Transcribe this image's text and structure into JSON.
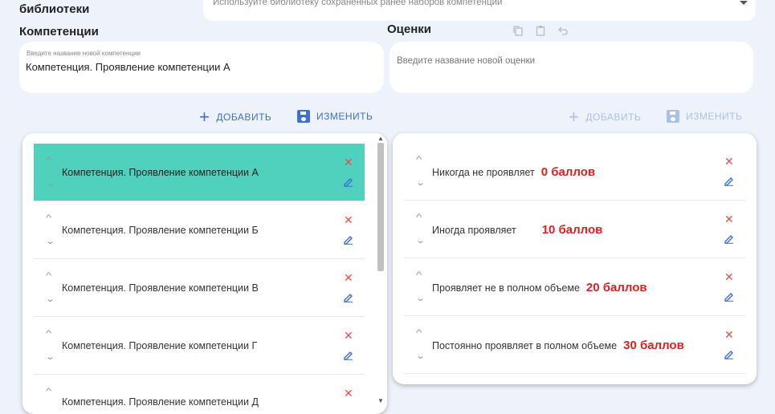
{
  "library": {
    "label": "библиотеки",
    "placeholder": "Используйте библиотеку сохраненных ранее наборов компетенций"
  },
  "competencies": {
    "title": "Компетенции",
    "input_label": "Введите название новой компетенции",
    "input_value": "Компетенция. Проявление компетенции А",
    "add_label": "ДОБАВИТЬ",
    "edit_label": "ИЗМЕНИТЬ",
    "items": [
      {
        "label": "Компетенция. Проявление компетенции А"
      },
      {
        "label": "Компетенция. Проявление компетенции Б"
      },
      {
        "label": "Компетенция. Проявление компетенции В"
      },
      {
        "label": "Компетенция. Проявление компетенции Г"
      },
      {
        "label": "Компетенция. Проявление компетенции Д"
      }
    ]
  },
  "ratings": {
    "title": "Оценки",
    "input_placeholder": "Введите название новой оценки",
    "add_label": "ДОБАВИТЬ",
    "edit_label": "ИЗМЕНИТЬ",
    "items": [
      {
        "label": "Никогда не проявляет",
        "score": "0 баллов"
      },
      {
        "label": "Иногда проявляет",
        "score": "10 баллов"
      },
      {
        "label": "Проявляет не в полном объеме",
        "score": "20 баллов"
      },
      {
        "label": "Постоянно проявляет в полном объеме",
        "score": "30 баллов"
      }
    ]
  },
  "colors": {
    "selected_row": "#4fd1bd",
    "accent": "#3d6fd6",
    "delete": "#e84c4c",
    "score": "#e02020"
  }
}
